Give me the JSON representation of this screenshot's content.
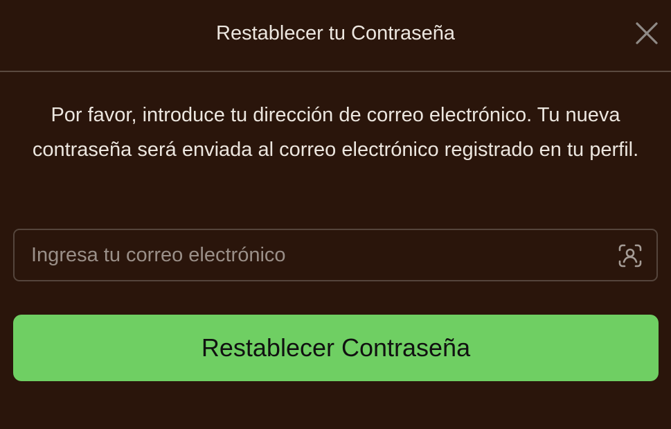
{
  "modal": {
    "title": "Restablecer tu Contraseña",
    "close_icon": "close-icon",
    "description": "Por favor, introduce tu dirección de correo electrónico. Tu nueva contraseña será enviada al correo electrónico registrado en tu perfil.",
    "email": {
      "placeholder": "Ingresa tu correo electrónico",
      "value": "",
      "icon": "contact-card-icon"
    },
    "submit_label": "Restablecer Contraseña"
  },
  "colors": {
    "background": "#2a150b",
    "text": "#ece6df",
    "placeholder": "#9a8f88",
    "border": "#55453c",
    "accent": "#6fcf63"
  }
}
